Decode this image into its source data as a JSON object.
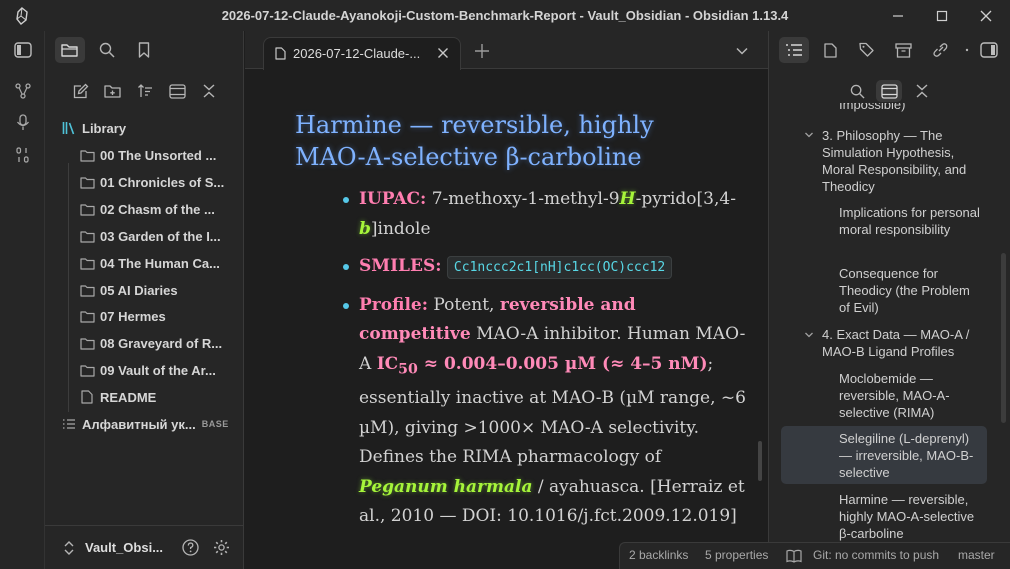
{
  "window": {
    "title": "2026-07-12-Claude-Ayanokoji-Custom-Benchmark-Report - Vault_Obsidian - Obsidian 1.13.4"
  },
  "left_sidebar": {
    "tree": [
      {
        "label": "Library",
        "type": "library"
      },
      {
        "label": "00 The Unsorted ...",
        "type": "folder"
      },
      {
        "label": "01 Chronicles of S...",
        "type": "folder"
      },
      {
        "label": "02 Chasm of the ...",
        "type": "folder"
      },
      {
        "label": "03 Garden of the I...",
        "type": "folder"
      },
      {
        "label": "04 The Human Ca...",
        "type": "folder"
      },
      {
        "label": "05 AI Diaries",
        "type": "folder"
      },
      {
        "label": "07 Hermes",
        "type": "folder"
      },
      {
        "label": "08 Graveyard of R...",
        "type": "folder"
      },
      {
        "label": "09 Vault of the Ar...",
        "type": "folder"
      },
      {
        "label": "README",
        "type": "file"
      },
      {
        "label": "Алфавитный ук...",
        "type": "base",
        "badge": "BASE"
      }
    ],
    "vault_name": "Vault_Obsi..."
  },
  "editor": {
    "tab_title": "2026-07-12-Claude-...",
    "heading": "Harmine — reversible, highly MAO-A-selective β-carboline",
    "bullets": {
      "iupac_label": "IUPAC:",
      "iupac_1": " 7-methoxy-1-methyl-9",
      "iupac_h": "H",
      "iupac_2": "-pyrido[3,4-",
      "iupac_b": "b",
      "iupac_3": "]indole",
      "smiles_label": "SMILES:",
      "smiles_code": "Cc1nccc2c1[nH]c1cc(OC)ccc12",
      "profile_label": "Profile:",
      "profile_1": " Potent, ",
      "profile_hl1": "reversible and competitive",
      "profile_2": " MAO-A inhibitor. Human MAO-A ",
      "profile_hl2a": "IC",
      "profile_hl2_sub": "50",
      "profile_hl2b": " ≈ 0.004–0.005 µM (≈ 4–5 nM)",
      "profile_3": "; essentially inactive at MAO-B (µM range, ~6 µM), giving >1000× MAO-A selectivity. Defines the RIMA pharmacology of ",
      "profile_hl3": "Peganum harmala",
      "profile_4": " / ayahuasca. [Herraiz et al., 2010 — DOI: 10.1016/j.fct.2009.12.019]"
    }
  },
  "outline": {
    "items": [
      {
        "text": "Impossible)",
        "level": 3
      },
      {
        "text": "3. Philosophy — The Simulation Hypothesis, Moral Responsibility, and Theodicy",
        "level": 2
      },
      {
        "text": "Implications for personal moral responsibility",
        "level": 3
      },
      {
        "text": "Consequence for Theodicy (the Problem of Evil)",
        "level": 3
      },
      {
        "text": "4. Exact Data — MAO-A / MAO-B Ligand Profiles",
        "level": 2
      },
      {
        "text": "Moclobemide — reversible, MAO-A-selective (RIMA)",
        "level": 3
      },
      {
        "text": "Selegiline (L-deprenyl) — irreversible, MAO-B-selective",
        "level": 3
      },
      {
        "text": "Harmine — reversible, highly MAO-A-selective β-carboline",
        "level": 3
      }
    ]
  },
  "statusbar": {
    "backlinks": "2 backlinks",
    "properties": "5 properties",
    "git": "Git: no commits to push",
    "branch": "master"
  },
  "colors": {
    "heading": "#7fb2ff",
    "label_pink": "#ff7eb0",
    "highlight_green": "#a6f53a",
    "code_cyan": "#58d8e6",
    "bullet": "#56c8e8"
  }
}
